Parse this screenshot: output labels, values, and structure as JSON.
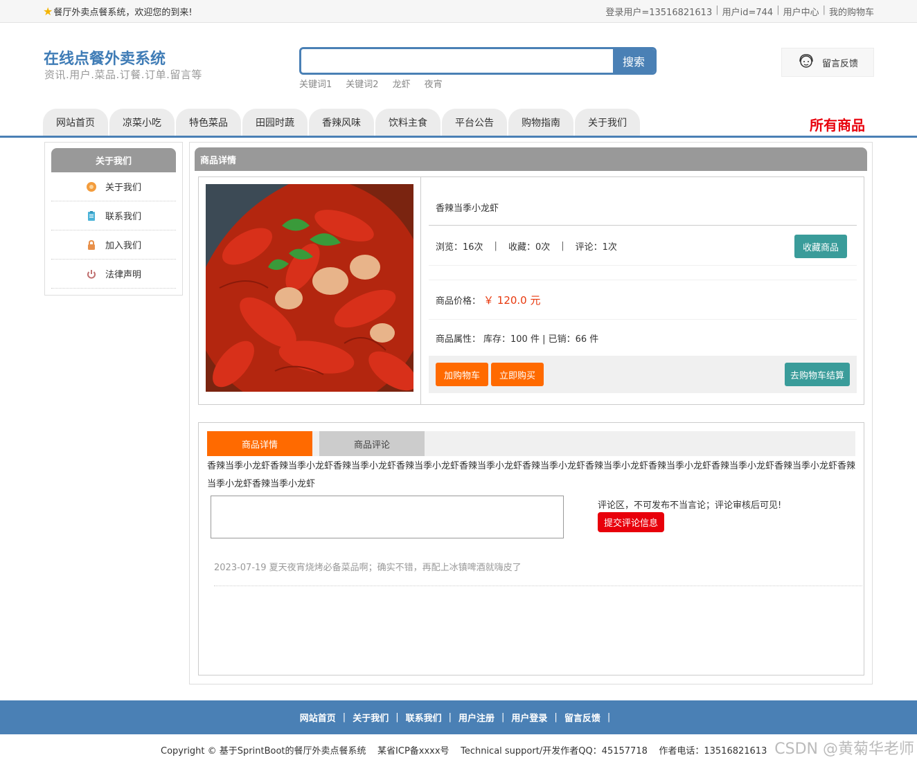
{
  "topbar": {
    "welcome": "餐厅外卖点餐系统，欢迎您的到来!",
    "links": [
      "登录用户=13516821613",
      "用户id=744",
      "用户中心",
      "我的购物车"
    ]
  },
  "header": {
    "title": "在线点餐外卖系统",
    "subtitle": "资讯.用户.菜品.订餐.订单.留言等",
    "search_value": "",
    "search_button": "搜索",
    "hotwords": [
      "关键词1",
      "关键词2",
      "龙虾",
      "夜宵"
    ],
    "feedback": "留言反馈"
  },
  "nav": {
    "items": [
      "网站首页",
      "凉菜小吃",
      "特色菜品",
      "田园时蔬",
      "香辣风味",
      "饮料主食",
      "平台公告",
      "购物指南",
      "关于我们"
    ],
    "all_goods": "所有商品"
  },
  "sidebar": {
    "title": "关于我们",
    "items": [
      {
        "label": "关于我们",
        "icon": "coin-icon",
        "color": "#f39c3c"
      },
      {
        "label": "联系我们",
        "icon": "clipboard-icon",
        "color": "#4bb3d8"
      },
      {
        "label": "加入我们",
        "icon": "lock-icon",
        "color": "#e8904a"
      },
      {
        "label": "法律声明",
        "icon": "power-icon",
        "color": "#c07070"
      }
    ]
  },
  "product": {
    "section_title": "商品详情",
    "name": "香辣当季小龙虾",
    "views_label": "浏览：16次",
    "favorites_label": "收藏：0次",
    "comments_label": "评论：1次",
    "favorite_button": "收藏商品",
    "price_label": "商品价格：",
    "price": "￥ 120.0 元",
    "attr_label": "商品属性：",
    "attr_value": "库存：100 件 | 已销：66 件",
    "add_cart_button": "加购物车",
    "buy_now_button": "立即购买",
    "checkout_button": "去购物车结算"
  },
  "tabs": {
    "items": [
      "商品详情",
      "商品评论"
    ],
    "description": "香辣当季小龙虾香辣当季小龙虾香辣当季小龙虾香辣当季小龙虾香辣当季小龙虾香辣当季小龙虾香辣当季小龙虾香辣当季小龙虾香辣当季小龙虾香辣当季小龙虾香辣当季小龙虾香辣当季小龙虾",
    "comment_value": "",
    "comment_tip": "评论区，不可发布不当言论；评论审核后可见!",
    "submit_button": "提交评论信息",
    "review": "2023-07-19 夏天夜宵烧烤必备菜品啊；确实不错，再配上冰镇啤酒就嗨皮了"
  },
  "footer": {
    "links": [
      "网站首页",
      "关于我们",
      "联系我们",
      "用户注册",
      "用户登录",
      "留言反馈"
    ],
    "copyright": "Copyright © 基于SprintBoot的餐厅外卖点餐系统    某省ICP备xxxx号    Technical support/开发作者QQ：45157718    作者电话：13516821613",
    "watermark": "CSDN @黄菊华老师"
  }
}
